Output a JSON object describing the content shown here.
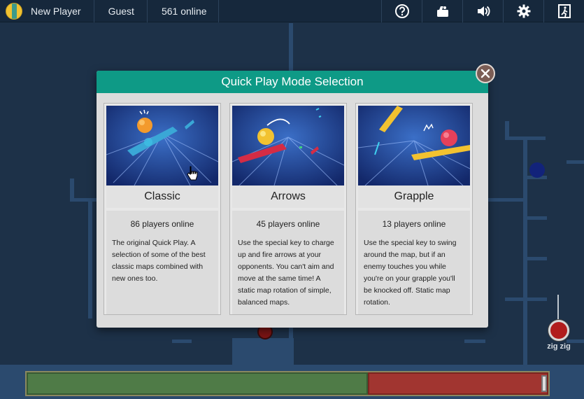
{
  "topbar": {
    "player_name": "New Player",
    "account": "Guest",
    "online": "561 online",
    "icons": [
      "help-icon",
      "camera-icon",
      "volume-icon",
      "settings-icon",
      "exit-icon"
    ]
  },
  "dialog": {
    "title": "Quick Play Mode Selection",
    "modes": [
      {
        "name": "Classic",
        "players": "86 players online",
        "description": "The original Quick Play. A selection of some of the best classic maps combined with new ones too."
      },
      {
        "name": "Arrows",
        "players": "45 players online",
        "description": "Use the special key to charge up and fire arrows at your opponents. You can't aim and move at the same time! A static map rotation of simple, balanced maps."
      },
      {
        "name": "Grapple",
        "players": "13 players online",
        "description": "Use the special key to swing around the map, but if an enemy touches you while you're on your grapple you'll be knocked off. Static map rotation."
      }
    ]
  },
  "game": {
    "player_label": "zig zig"
  },
  "colors": {
    "accent": "#0e9a86",
    "background": "#1d3148",
    "topbar": "#16283c",
    "bar_green": "#4f7b47",
    "bar_red": "#a13530"
  }
}
